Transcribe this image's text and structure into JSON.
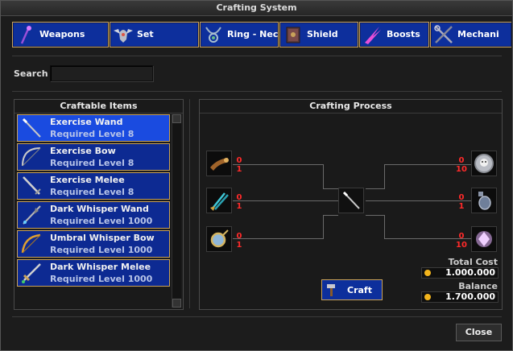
{
  "window": {
    "title": "Crafting System"
  },
  "tabs": [
    {
      "label": "Weapons",
      "icon": "wand-icon"
    },
    {
      "label": "Set",
      "icon": "winged-helmet-icon"
    },
    {
      "label": "Ring - Neck",
      "icon": "necklace-icon"
    },
    {
      "label": "Shield",
      "icon": "spellbook-icon"
    },
    {
      "label": "Boosts",
      "icon": "energy-wings-icon"
    },
    {
      "label": "Mechani",
      "icon": "crossed-tools-icon"
    }
  ],
  "search": {
    "label": "Search",
    "value": ""
  },
  "craftable": {
    "header": "Craftable Items",
    "items": [
      {
        "name": "Exercise Wand",
        "level": "Required Level 8",
        "icon": "wand-icon"
      },
      {
        "name": "Exercise Bow",
        "level": "Required Level 8",
        "icon": "bow-icon"
      },
      {
        "name": "Exercise Melee",
        "level": "Required Level 8",
        "icon": "sword-icon"
      },
      {
        "name": "Dark Whisper Wand",
        "level": "Required Level 1000",
        "icon": "dark-wand-icon"
      },
      {
        "name": "Umbral Whisper Bow",
        "level": "Required Level 1000",
        "icon": "umbral-bow-icon"
      },
      {
        "name": "Dark Whisper Melee",
        "level": "Required Level 1000",
        "icon": "dark-sword-icon"
      }
    ],
    "selected_index": 0
  },
  "process": {
    "header": "Crafting Process",
    "left_ingredients": [
      {
        "icon": "horn-icon",
        "have": "0",
        "need": "1"
      },
      {
        "icon": "feather-darts-icon",
        "have": "0",
        "need": "1"
      },
      {
        "icon": "monocle-icon",
        "have": "0",
        "need": "1"
      }
    ],
    "right_ingredients": [
      {
        "icon": "silver-skull-coin-icon",
        "have": "0",
        "need": "10"
      },
      {
        "icon": "potion-flask-icon",
        "have": "0",
        "need": "1"
      },
      {
        "icon": "pink-crystal-icon",
        "have": "0",
        "need": "10"
      }
    ],
    "result_icon": "wand-icon",
    "total_cost_label": "Total Cost",
    "total_cost": "1.000.000",
    "balance_label": "Balance",
    "balance": "1.700.000",
    "craft_label": "Craft",
    "craft_icon": "hammer-icon"
  },
  "footer": {
    "close_label": "Close"
  },
  "colors": {
    "tab_blue": "#0d2f9c",
    "gold_border": "#c9a25a",
    "need_red": "#ff2a2a",
    "coin": "#f2b41c"
  }
}
